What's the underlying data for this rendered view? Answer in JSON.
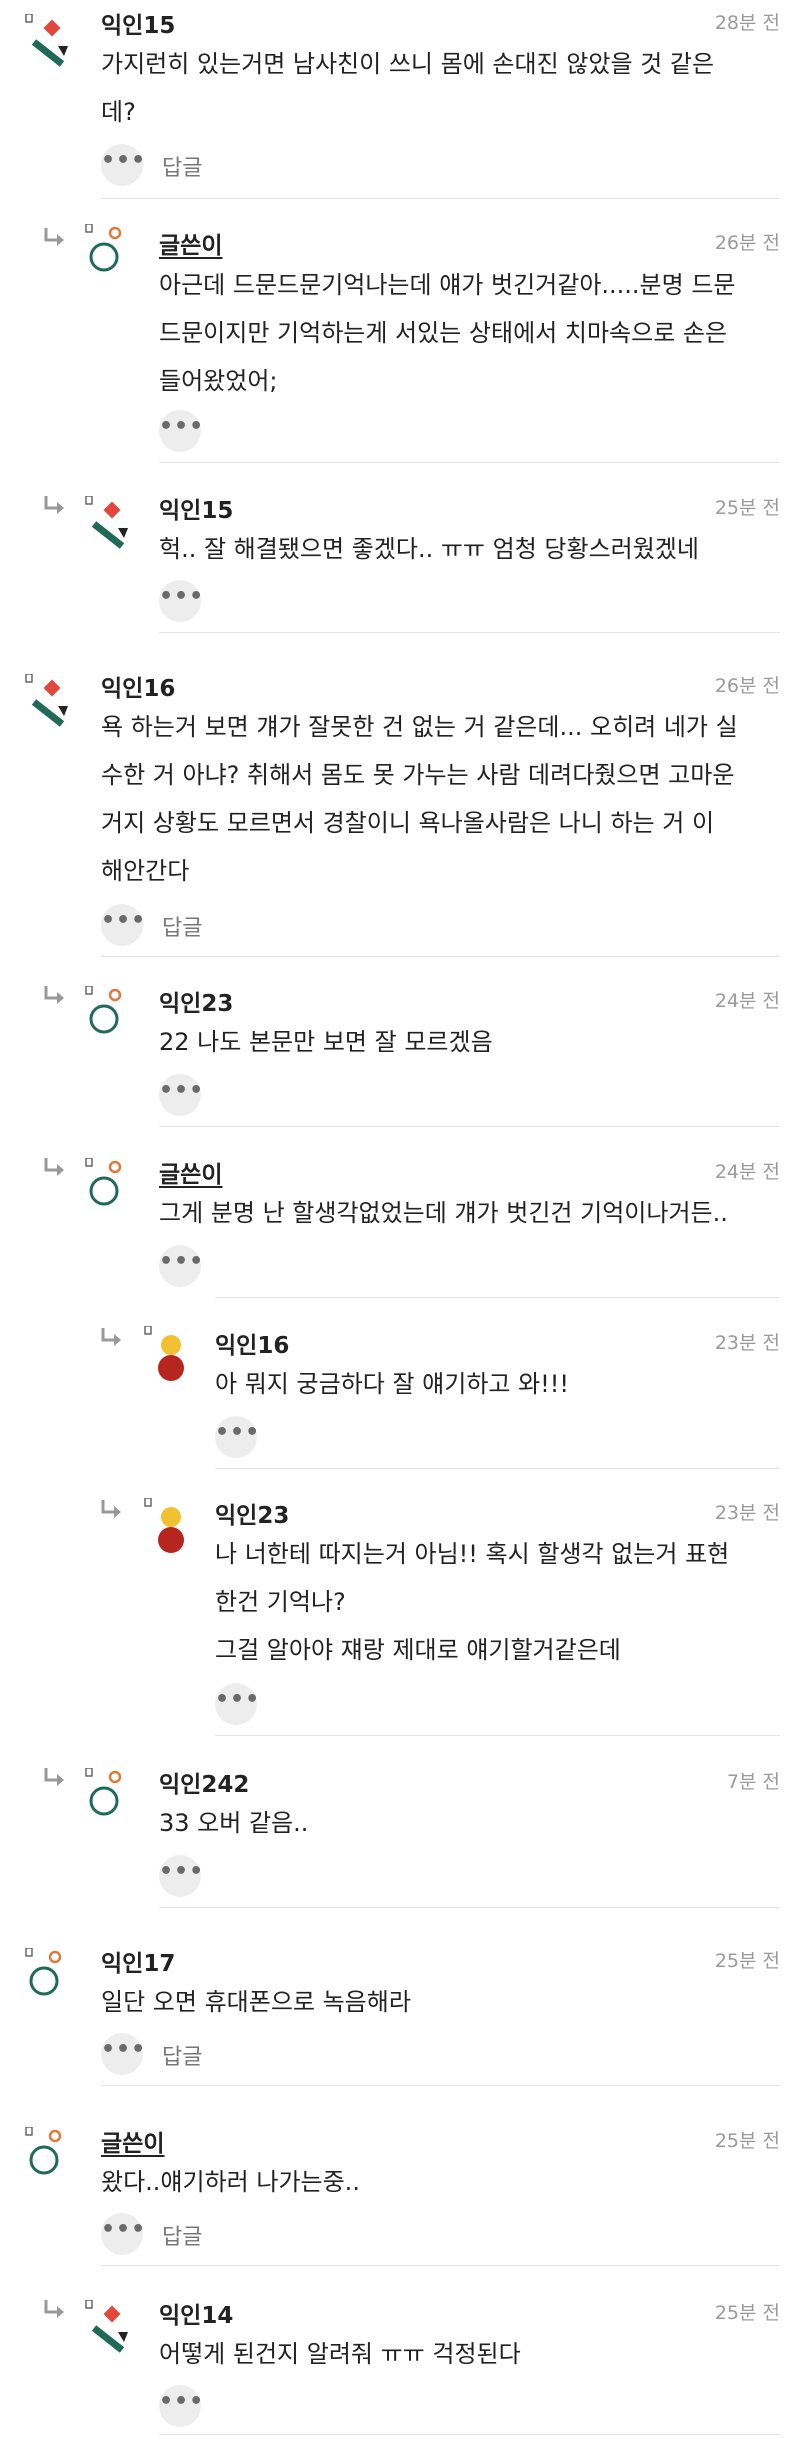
{
  "comments": [
    {
      "author": "익인15",
      "time": "28분 전",
      "lines": [
        "가지런히 있는거면 남사친이 쓰니 몸에 손대진 않았을 것 같은",
        "데?"
      ],
      "more": "•••",
      "reply": "답글",
      "avatar": "diamond-icon"
    },
    {
      "author": "글쓴이",
      "time": "26분 전",
      "lines": [
        "아근데 드문드문기억나는데 얘가 벗긴거같아.....분명 드문",
        "드문이지만 기억하는게 서있는 상태에서 치마속으로 손은",
        "들어왔었어;"
      ],
      "more": "•••",
      "avatar": "circle-icon"
    },
    {
      "author": "익인15",
      "time": "25분 전",
      "lines": [
        "헉.. 잘 해결됐으면 좋겠다.. ㅠㅠ 엄청 당황스러웠겠네"
      ],
      "more": "•••",
      "avatar": "diamond-icon"
    },
    {
      "author": "익인16",
      "time": "26분 전",
      "lines": [
        "욕 하는거 보면 걔가 잘못한 건 없는 거 같은데... 오히려 네가 실",
        "수한 거 아냐? 취해서 몸도 못 가누는 사람 데려다줬으면 고마운",
        "거지 상황도 모르면서 경찰이니 욕나올사람은 나니 하는 거 이",
        "해안간다"
      ],
      "more": "•••",
      "reply": "답글",
      "avatar": "diamond-icon"
    },
    {
      "author": "익인23",
      "time": "24분 전",
      "lines": [
        "22 나도 본문만 보면 잘 모르겠음"
      ],
      "more": "•••",
      "avatar": "circle-icon"
    },
    {
      "author": "글쓴이",
      "time": "24분 전",
      "lines": [
        "그게 분명 난 할생각없었는데 걔가 벗긴건 기억이나거든.."
      ],
      "more": "•••",
      "avatar": "circle-icon"
    },
    {
      "author": "익인16",
      "time": "23분 전",
      "lines": [
        "아 뭐지 궁금하다 잘 얘기하고 와!!!"
      ],
      "more": "•••",
      "avatar": "person-icon"
    },
    {
      "author": "익인23",
      "time": "23분 전",
      "lines": [
        "나 너한테 따지는거 아님!! 혹시 할생각 없는거 표현",
        "한건 기억나?",
        "그걸 알아야 쟤랑 제대로 얘기할거같은데"
      ],
      "more": "•••",
      "avatar": "person-icon"
    },
    {
      "author": "익인242",
      "time": "7분 전",
      "lines": [
        "33 오버 같음.."
      ],
      "more": "•••",
      "avatar": "circle-icon"
    },
    {
      "author": "익인17",
      "time": "25분 전",
      "lines": [
        "일단 오면 휴대폰으로 녹음해라"
      ],
      "more": "•••",
      "reply": "답글",
      "avatar": "circle-icon"
    },
    {
      "author": "글쓴이",
      "time": "25분 전",
      "lines": [
        "왔다..얘기하러 나가는중.."
      ],
      "more": "•••",
      "reply": "답글",
      "avatar": "circle-icon"
    },
    {
      "author": "익인14",
      "time": "25분 전",
      "lines": [
        "어떻게 된건지 알려줘 ㅠㅠ 걱정된다"
      ],
      "more": "•••",
      "avatar": "diamond-icon"
    }
  ]
}
